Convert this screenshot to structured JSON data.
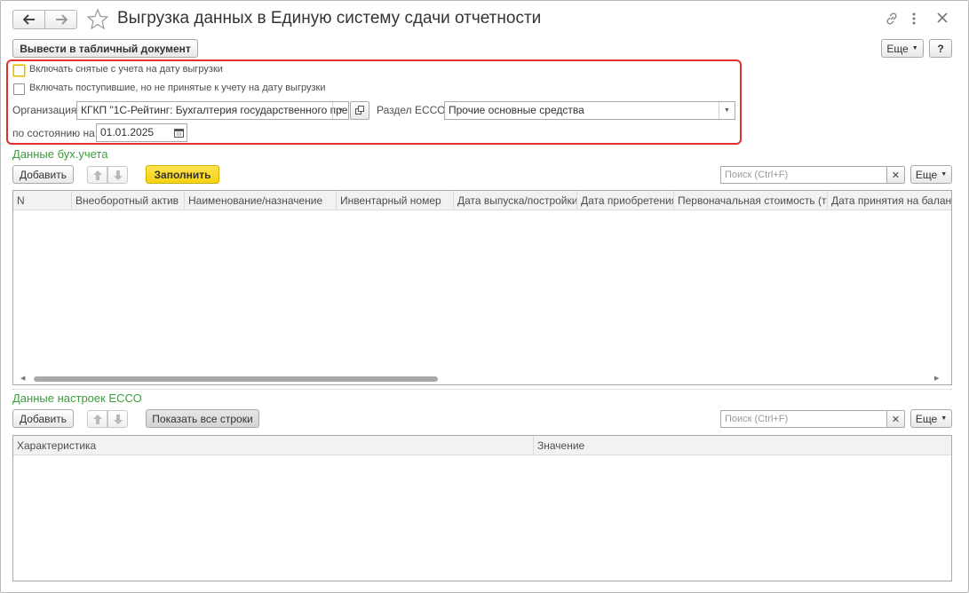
{
  "window": {
    "title": "Выгрузка данных в  Единую систему сдачи отчетности"
  },
  "toolbar": {
    "print_label": "Вывести в табличный документ",
    "more_label": "Еще",
    "help_label": "?"
  },
  "filters": {
    "include_removed_label": "Включать снятые с учета на дату выгрузки",
    "include_removed_checked": false,
    "include_received_label": "Включать поступившие, но не принятые к учету на дату выгрузки",
    "include_received_checked": false,
    "organization_label": "Организация:",
    "organization_value": "КГКП \"1С-Рейтинг: Бухгалтерия государственного пре",
    "section_label": "Раздел ЕССО:",
    "section_value": "Прочие основные средства",
    "date_label": "по состоянию на :",
    "date_value": "01.01.2025"
  },
  "accounting_group": {
    "title": "Данные бух.учета",
    "add_label": "Добавить",
    "fill_label": "Заполнить",
    "search_placeholder": "Поиск (Ctrl+F)",
    "more_label": "Еще",
    "columns": [
      "N",
      "Внеоборотный актив",
      "Наименование/назначение",
      "Инвентарный номер",
      "Дата выпуска/постройки",
      "Дата приобретения",
      "Первоначальная стоимость (тг.)",
      "Дата принятия на баланс"
    ],
    "rows": []
  },
  "settings_group": {
    "title": "Данные настроек  ЕССО",
    "add_label": "Добавить",
    "show_all_label": "Показать все строки",
    "search_placeholder": "Поиск (Ctrl+F)",
    "more_label": "Еще",
    "columns": [
      "Характеристика",
      "Значение"
    ],
    "rows": []
  },
  "colors": {
    "accent_green": "#3e9b3e",
    "fill_button_yellow": "#f5d211",
    "highlight_red": "#e03030"
  }
}
